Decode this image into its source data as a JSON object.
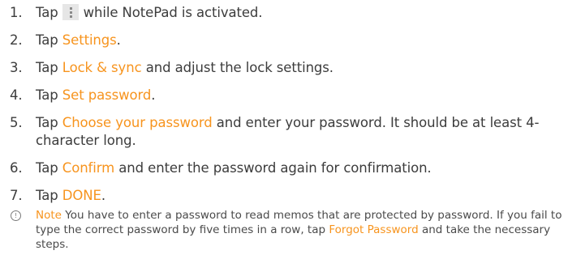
{
  "steps": [
    {
      "num": "1.",
      "pre": "Tap",
      "post": "while NotePad is activated."
    },
    {
      "num": "2.",
      "pre": "Tap ",
      "hl": "Settings",
      "post": "."
    },
    {
      "num": "3.",
      "pre": "Tap ",
      "hl": "Lock & sync",
      "post": " and adjust the lock settings."
    },
    {
      "num": "4.",
      "pre": "Tap ",
      "hl": "Set password",
      "post": "."
    },
    {
      "num": "5.",
      "pre": "Tap ",
      "hl": "Choose your password",
      "post": " and enter your password. It should be at least 4-character long."
    },
    {
      "num": "6.",
      "pre": "Tap ",
      "hl": "Confirm",
      "post": " and enter the password again for confirmation."
    },
    {
      "num": "7.",
      "pre": "Tap ",
      "hl": "DONE",
      "post": "."
    }
  ],
  "note": {
    "icon_symbol": "!",
    "label": "Note",
    "text_before": " You have to enter a password to read memos that are protected by password. If you fail to type the correct password by five times in a row, tap ",
    "link": "Forgot Password",
    "text_after": " and take the necessary steps."
  },
  "icons": {
    "menu": "menu-icon",
    "note": "note-icon"
  },
  "colors": {
    "highlight": "#f7941e",
    "text": "#3c3c3c"
  }
}
